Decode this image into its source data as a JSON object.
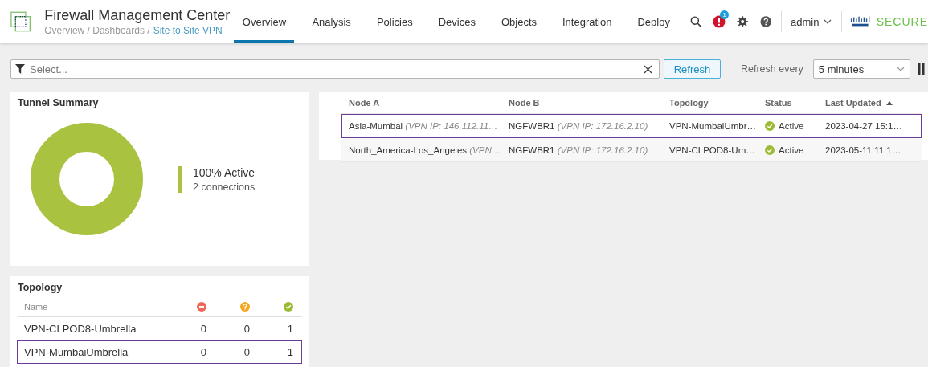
{
  "header": {
    "title": "Firewall Management Center",
    "breadcrumb": "Overview / Dashboards /",
    "breadcrumb_current": "Site to Site VPN",
    "tabs": [
      {
        "label": "Overview",
        "selected": true
      },
      {
        "label": "Analysis",
        "selected": false
      },
      {
        "label": "Policies",
        "selected": false
      },
      {
        "label": "Devices",
        "selected": false
      },
      {
        "label": "Objects",
        "selected": false
      },
      {
        "label": "Integration",
        "selected": false
      },
      {
        "label": "Deploy",
        "selected": false
      }
    ],
    "alert_count": "1",
    "user": "admin",
    "brand": "SECURE"
  },
  "filter": {
    "placeholder": "Select...",
    "refresh_button": "Refresh",
    "refresh_label": "Refresh every",
    "interval": "5 minutes"
  },
  "tunnel_summary": {
    "title": "Tunnel Summary",
    "legend_value": "100% Active",
    "legend_sub": "2 connections"
  },
  "topology": {
    "title": "Topology",
    "name_header": "Name",
    "rows": [
      {
        "name": "VPN-CLPOD8-Umbrella",
        "down": "0",
        "unknown": "0",
        "active": "1",
        "highlighted": false
      },
      {
        "name": "VPN-MumbaiUmbrella",
        "down": "0",
        "unknown": "0",
        "active": "1",
        "highlighted": true
      }
    ]
  },
  "tunnels": {
    "columns": [
      "Node A",
      "Node B",
      "Topology",
      "Status",
      "Last Updated"
    ],
    "rows": [
      {
        "node_a": "Asia-Mumbai",
        "node_a_ip": "(VPN IP: 146.112.11…",
        "node_b": "NGFWBR1",
        "node_b_ip": "(VPN IP: 172.16.2.10)",
        "topology": "VPN-MumbaiUmbr…",
        "status": "Active",
        "last_updated": "2023-04-27 15:1…",
        "highlighted": true
      },
      {
        "node_a": "North_America-Los_Angeles",
        "node_a_ip": "(VPN…",
        "node_b": "NGFWBR1",
        "node_b_ip": "(VPN IP: 172.16.2.10)",
        "topology": "VPN-CLPOD8-Um…",
        "status": "Active",
        "last_updated": "2023-05-11 11:1…",
        "highlighted": false
      }
    ]
  }
}
